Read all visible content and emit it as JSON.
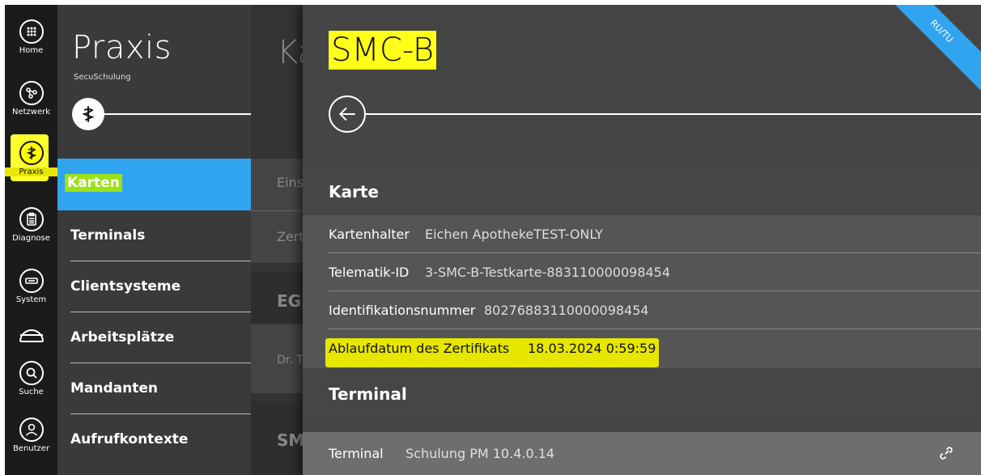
{
  "rail": {
    "items": [
      {
        "label": "Home",
        "icon": "grid-icon"
      },
      {
        "label": "Netzwerk",
        "icon": "network-icon"
      },
      {
        "label": "Praxis",
        "icon": "caduceus-icon"
      },
      {
        "label": "Diagnose",
        "icon": "clipboard-icon"
      },
      {
        "label": "System",
        "icon": "system-icon"
      },
      {
        "label": "",
        "icon": "connector-icon"
      },
      {
        "label": "Suche",
        "icon": "search-icon"
      },
      {
        "label": "Benutzer",
        "icon": "user-icon"
      }
    ]
  },
  "praxis": {
    "title": "Praxis",
    "subtitle": "SecuSchulung",
    "nav": [
      {
        "label": "Karten"
      },
      {
        "label": "Terminals"
      },
      {
        "label": "Clientsysteme"
      },
      {
        "label": "Arbeitsplätze"
      },
      {
        "label": "Mandanten"
      },
      {
        "label": "Aufrufkontexte"
      }
    ]
  },
  "middle": {
    "title_fragment": "Ka",
    "rows": [
      "Eins",
      "Zert",
      "EGI",
      "Dr. T",
      "SM"
    ]
  },
  "detail": {
    "title": "SMC-B",
    "ribbon": "RU/TU",
    "karte_heading": "Karte",
    "fields": [
      {
        "key": "Kartenhalter",
        "value": "Eichen ApothekeTEST-ONLY"
      },
      {
        "key": "Telematik-ID",
        "value": "3-SMC-B-Testkarte-883110000098454"
      },
      {
        "key": "Identifikationsnummer",
        "value": "80276883110000098454"
      },
      {
        "key": "Ablaufdatum des Zertifikats",
        "value": "18.03.2024 0:59:59"
      }
    ],
    "terminal_heading": "Terminal",
    "terminal": {
      "key": "Terminal",
      "value": "Schulung PM 10.4.0.14"
    }
  },
  "colors": {
    "accent_blue": "#31a4f0",
    "highlight_yellow": "#ffff00",
    "highlight_green": "#9be21a"
  }
}
